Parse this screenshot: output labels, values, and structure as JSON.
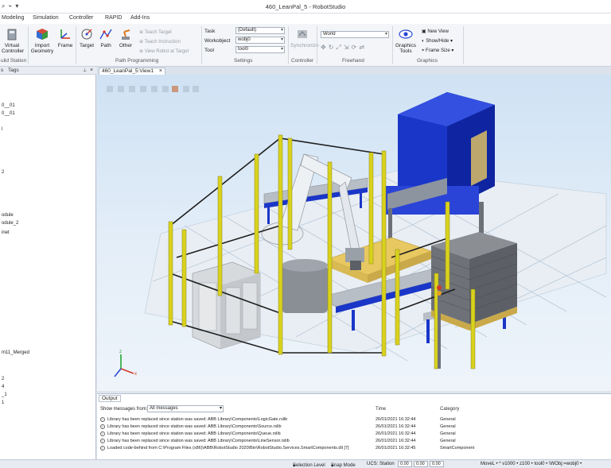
{
  "window": {
    "title": "460_LeanPal_5 - RobotStudio",
    "qat_icons": [
      "search-icon",
      "link-icon",
      "pin-icon"
    ]
  },
  "menu_tabs": [
    "Modeling",
    "Simulation",
    "Controller",
    "RAPID",
    "Add-Ins"
  ],
  "ribbon": {
    "build_station": {
      "virtual_controller": "Virtual\nController",
      "label": "uild Station"
    },
    "import_geometry": "Import\nGeometry",
    "frame": "Frame",
    "target": "Target",
    "path": "Path",
    "other": "Other",
    "teach_target": "Teach Target",
    "teach_instruction": "Teach Instruction",
    "view_robot_at_target": "View Robot at Target",
    "path_programming_label": "Path Programming",
    "settings": {
      "task_label": "Task",
      "task_value": "(Default)",
      "workobject_label": "Workobject",
      "workobject_value": "wobj0",
      "tool_label": "Tool",
      "tool_value": "tool0",
      "label": "Settings"
    },
    "synchronize": "Synchronize",
    "controller_label": "Controller",
    "freehand": {
      "frame_value": "World",
      "label": "Freehand"
    },
    "graphics_tools": "Graphics\nTools",
    "new_view": "New View",
    "show_hide": "Show/Hide",
    "frame_size": "Frame Size",
    "graphics_label": "Graphics"
  },
  "left_panel": {
    "tabs": [
      "s",
      "Tags"
    ],
    "tree": [
      "0__01",
      "0__01",
      "l",
      "2",
      "odule",
      "odule_2",
      "inet",
      "m11_Merged",
      "2",
      "4",
      "_1",
      "1"
    ]
  },
  "view_tab": "460_LeanPal_5:View1",
  "output": {
    "tab": "Output",
    "filter_label": "Show messages from:",
    "filter_value": "All messages",
    "columns": {
      "time": "Time",
      "category": "Category"
    },
    "messages": [
      {
        "text": "Library has been replaced since station was saved: ABB Library\\Components\\LogicGate.rslib",
        "time": "26/01/2021 16:32:44",
        "category": "General"
      },
      {
        "text": "Library has been replaced since station was saved: ABB Library\\Components\\Source.rslib",
        "time": "26/01/2021 16:32:44",
        "category": "General"
      },
      {
        "text": "Library has been replaced since station was saved: ABB Library\\Components\\Queue.rslib",
        "time": "26/01/2021 16:32:44",
        "category": "General"
      },
      {
        "text": "Library has been replaced since station was saved: ABB Library\\Components\\LineSensor.rslib",
        "time": "26/01/2021 16:32:44",
        "category": "General"
      },
      {
        "text": "Loaded code-behind from C:\\Program Files (x86)\\ABB\\RobotStudio 2020\\Bin\\RobotStudio.Services.SmartComponents.dll [7]",
        "time": "26/01/2021 16:32:45",
        "category": "SmartComponent"
      }
    ]
  },
  "status_bar": {
    "selection_level": "Selection Level",
    "snap_mode": "Snap Mode",
    "ucs_station": "UCS: Station",
    "coord1": "0.00",
    "coord2": "0.00",
    "coord3": "0.00",
    "motion": "MoveL  •  * v1000  •  z100  •  tool0  •  \\WObj:=wobj0  •"
  },
  "colors": {
    "frame_blue": "#1133dd",
    "guard_yellow": "#d9d21c",
    "pallet": "#e8c860",
    "hopper": "#1a36c8"
  }
}
